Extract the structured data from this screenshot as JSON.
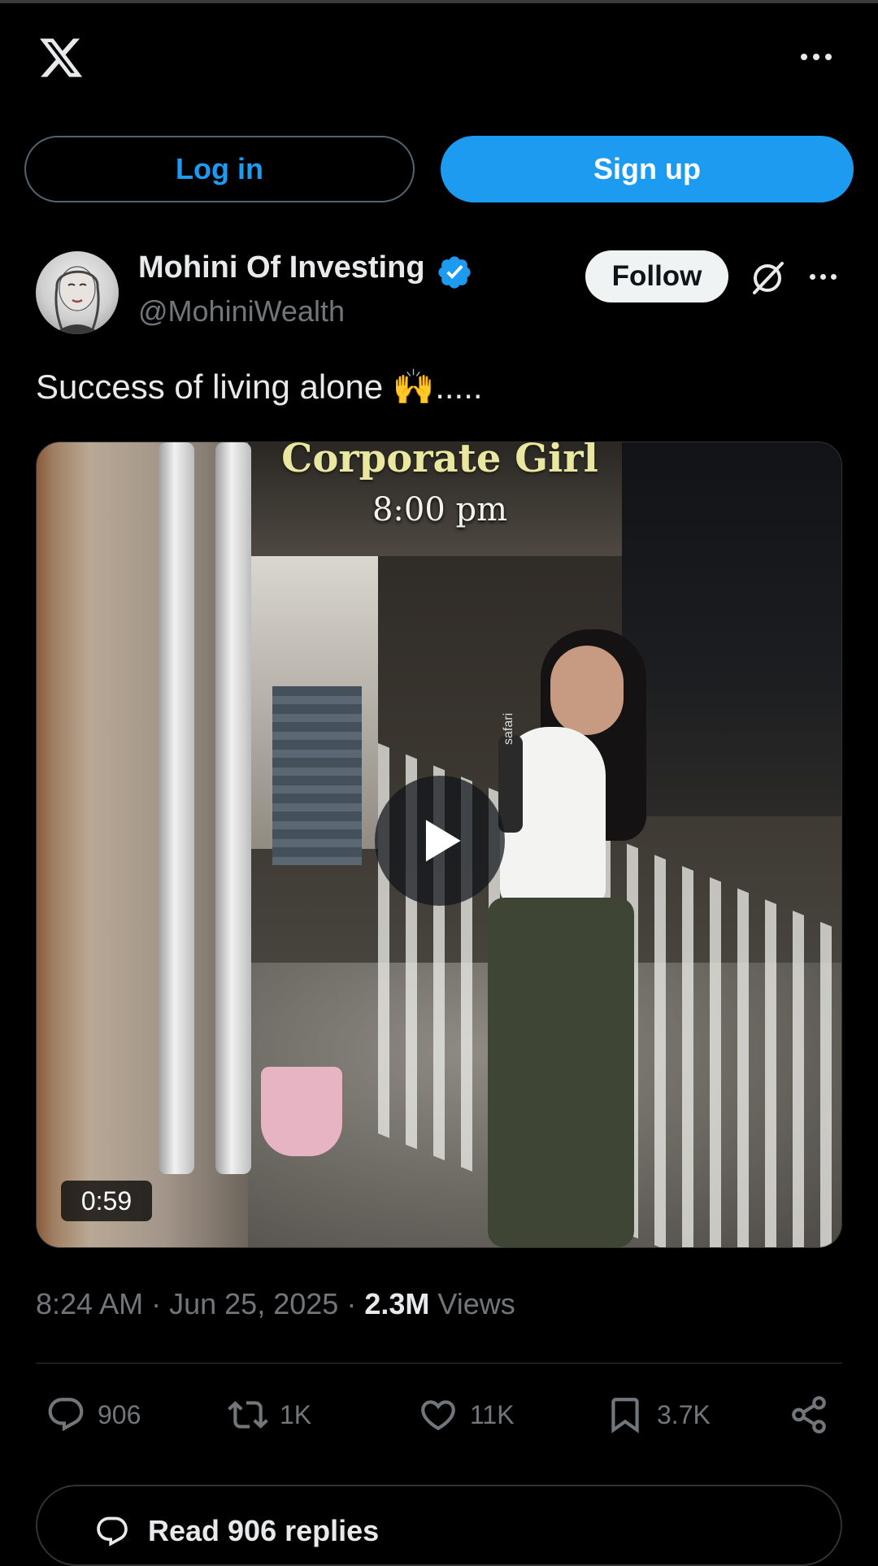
{
  "header": {
    "logo_icon": "x-logo-icon",
    "more_icon": "more-horizontal-icon"
  },
  "auth": {
    "login_label": "Log in",
    "signup_label": "Sign up"
  },
  "post": {
    "author_name": "Mohini Of Investing",
    "verified": true,
    "handle": "@MohiniWealth",
    "follow_label": "Follow",
    "text": "Success of living alone 🙌.....",
    "video": {
      "caption_top": "Corporate Girl",
      "caption_time": "8:00 pm",
      "overlay_label": "safari",
      "duration": "0:59"
    },
    "meta": {
      "time": "8:24 AM",
      "date": "Jun 25, 2025",
      "views_count": "2.3M",
      "views_label": "Views"
    },
    "actions": {
      "replies": "906",
      "reposts": "1K",
      "likes": "11K",
      "bookmarks": "3.7K"
    },
    "read_replies_label": "Read 906 replies"
  },
  "colors": {
    "accent": "#1d9bf0",
    "background": "#000000",
    "muted": "#71767b",
    "text": "#e7e9ea"
  }
}
